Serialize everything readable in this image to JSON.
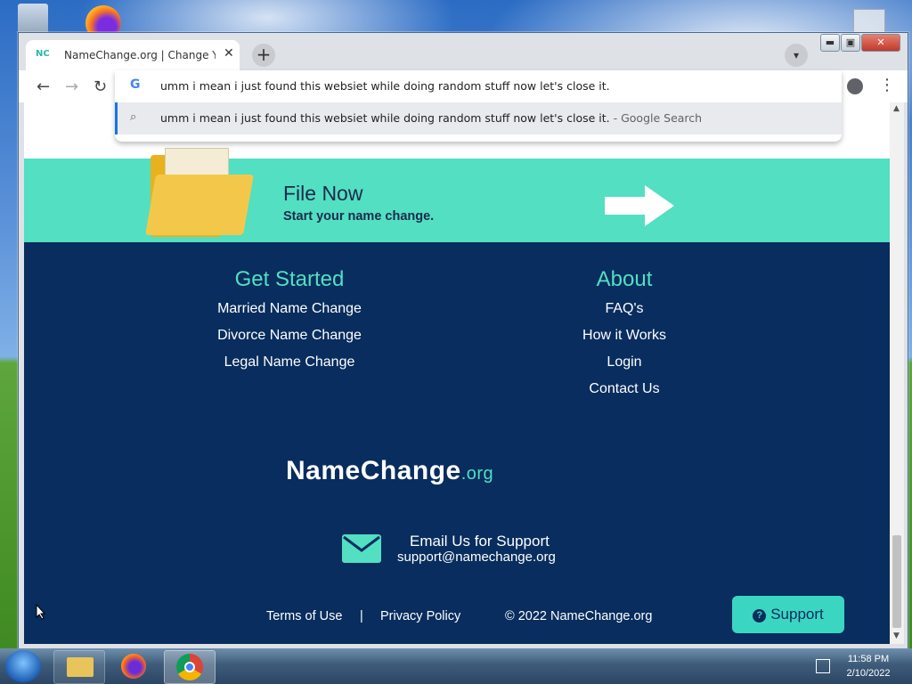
{
  "browser": {
    "tab_favicon": "NC",
    "tab_title": "NameChange.org | Change Your",
    "tab_close": "✕",
    "new_tab": "+",
    "window_buttons": {
      "minimize": "▬",
      "maximize": "▣",
      "close": "✕"
    }
  },
  "omnibox": {
    "query": "umm i mean i just found this websiet while doing random stuff now let's close it.",
    "suggestion": "umm i mean i just found this websiet while doing random stuff now let's close it.",
    "suggestion_suffix": "- Google Search"
  },
  "banner": {
    "title": "File Now",
    "subtitle": "Start your name change."
  },
  "footer": {
    "get_started": {
      "heading": "Get Started",
      "links": [
        "Married Name Change",
        "Divorce Name Change",
        "Legal Name Change"
      ]
    },
    "about": {
      "heading": "About",
      "links": [
        "FAQ's",
        "How it Works",
        "Login",
        "Contact Us"
      ]
    },
    "brand": "NameChange",
    "brand_suffix": ".org",
    "email_heading": "Email Us for Support",
    "email_address": "support@namechange.org",
    "terms": "Terms of Use",
    "separator": "|",
    "privacy": "Privacy Policy",
    "copyright": "© 2022 NameChange.org",
    "support_button": "Support"
  },
  "taskbar": {
    "time": "11:58 PM",
    "date": "2/10/2022"
  },
  "colors": {
    "accent": "#52dfc2",
    "footer_bg": "#082d5e"
  }
}
